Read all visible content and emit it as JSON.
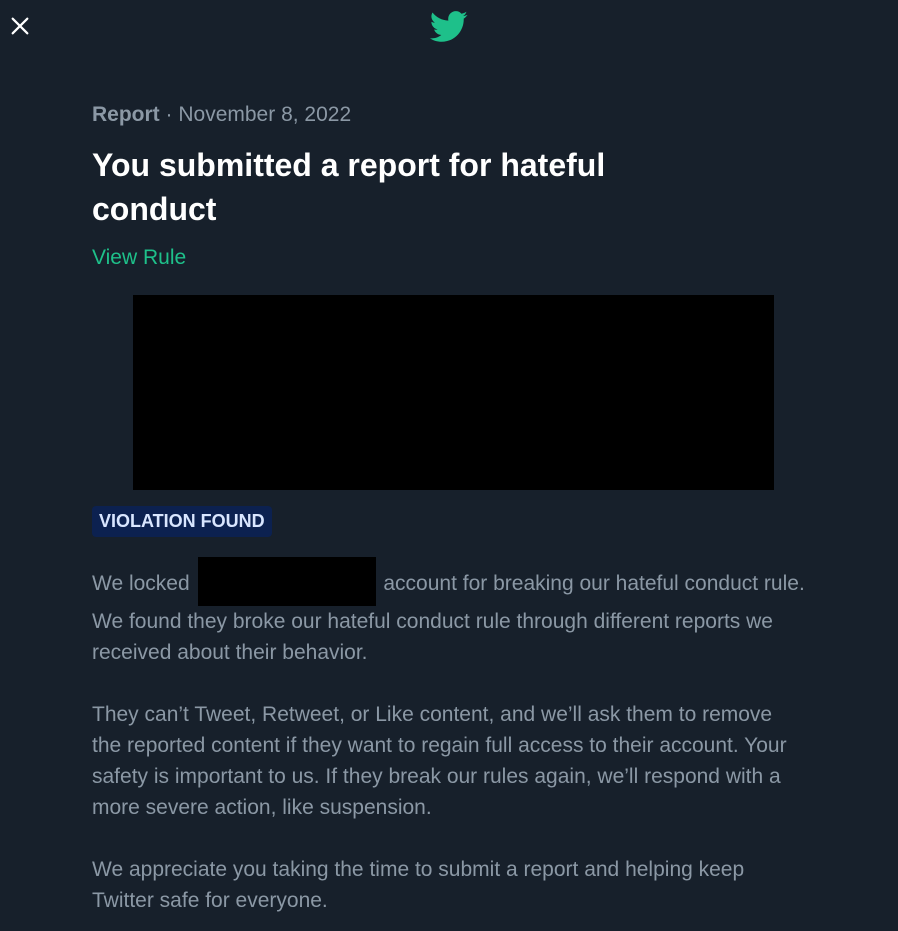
{
  "header": {
    "close_icon": "close-icon",
    "logo_icon": "twitter-bird-icon",
    "accent_color": "#1ec08a"
  },
  "report": {
    "type": "Report",
    "separator": "·",
    "date": "November 8, 2022",
    "title": "You submitted a report for hateful conduct",
    "view_rule": "View Rule",
    "status_badge": "VIOLATION FOUND"
  },
  "message": {
    "p1_prefix": "We locked",
    "p1_suffix": "account for breaking our hateful conduct rule. We found they broke our hateful conduct rule through different reports we received about their behavior.",
    "p2": "They can’t Tweet, Retweet, or Like content, and we’ll ask them to remove the reported content if they want to regain full access to their account. Your safety is important to us. If they break our rules again, we’ll respond with a more severe action, like suspension.",
    "p3": "We appreciate you taking the time to submit a report and helping keep Twitter safe for everyone."
  }
}
